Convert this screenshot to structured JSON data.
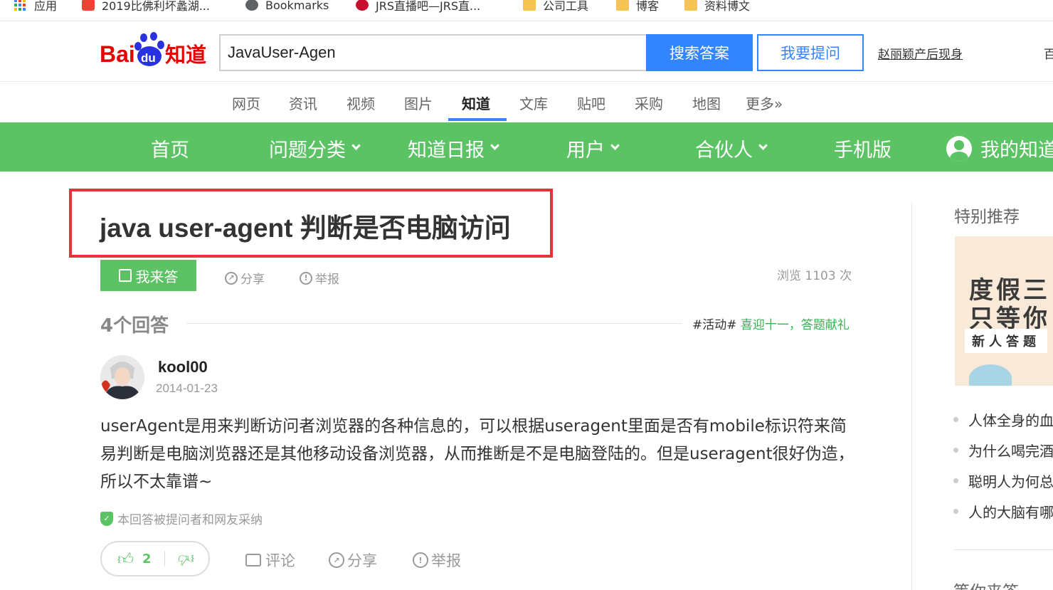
{
  "bookmarks": [
    {
      "label": "应用",
      "icon": "apps-grid-icon"
    },
    {
      "label": "2019比佛利坏蠡湖...",
      "icon": "site-logo-icon"
    },
    {
      "label": "Bookmarks",
      "icon": "globe-icon"
    },
    {
      "label": "JRS直播吧—JRS直...",
      "icon": "basketball-icon"
    },
    {
      "label": "公司工具",
      "icon": "folder-icon"
    },
    {
      "label": "博客",
      "icon": "folder-icon"
    },
    {
      "label": "资料博文",
      "icon": "folder-icon"
    }
  ],
  "header": {
    "logo_text_bai": "Bai",
    "logo_text_du": "du",
    "logo_text_zhidao": "知道",
    "search_value": "JavaUser-Agen",
    "search_button": "搜索答案",
    "ask_button": "我要提问",
    "hot_link": "赵丽颖产后现身",
    "hot_link2": "百"
  },
  "categories": [
    {
      "label": "网页"
    },
    {
      "label": "资讯"
    },
    {
      "label": "视频"
    },
    {
      "label": "图片"
    },
    {
      "label": "知道",
      "active": true
    },
    {
      "label": "文库"
    },
    {
      "label": "贴吧"
    },
    {
      "label": "采购"
    },
    {
      "label": "地图"
    },
    {
      "label": "更多»"
    }
  ],
  "green_nav": {
    "home": "首页",
    "categories": "问题分类",
    "daily": "知道日报",
    "users": "用户",
    "partners": "合伙人",
    "mobile": "手机版",
    "my_zhidao": "我的知道"
  },
  "question": {
    "title": "java user-agent 判断是否电脑访问",
    "answer_button": "我来答",
    "share": "分享",
    "report": "举报",
    "views": "浏览 1103 次",
    "highlight_color": "#e8323a"
  },
  "answers_header": {
    "count": "4个回答",
    "activity_tag": "#活动#",
    "activity_link": "喜迎十一，答题献礼"
  },
  "answer": {
    "username": "kool00",
    "date": "2014-01-23",
    "body": "userAgent是用来判断访问者浏览器的各种信息的，可以根据useragent里面是否有mobile标识符来简易判断是电脑浏览器还是其他移动设备浏览器，从而推断是不是电脑登陆的。但是useragent很好伪造，所以不太靠谱~",
    "adopted": "本回答被提问者和网友采纳",
    "likes": "2",
    "comment": "评论",
    "share": "分享",
    "report": "举报"
  },
  "sidebar": {
    "title": "特别推荐",
    "promo_line1": "度假三",
    "promo_line2": "只等你",
    "promo_line3": "新人答题",
    "items": [
      {
        "label": "人体全身的血"
      },
      {
        "label": "为什么喝完酒"
      },
      {
        "label": "聪明人为何总"
      },
      {
        "label": "人的大脑有哪"
      }
    ],
    "title2": "等你来答"
  },
  "colors": {
    "brand_green": "#5bc363",
    "search_blue": "#3385ff",
    "baidu_red": "#e10602",
    "baidu_blue": "#2932e1"
  }
}
